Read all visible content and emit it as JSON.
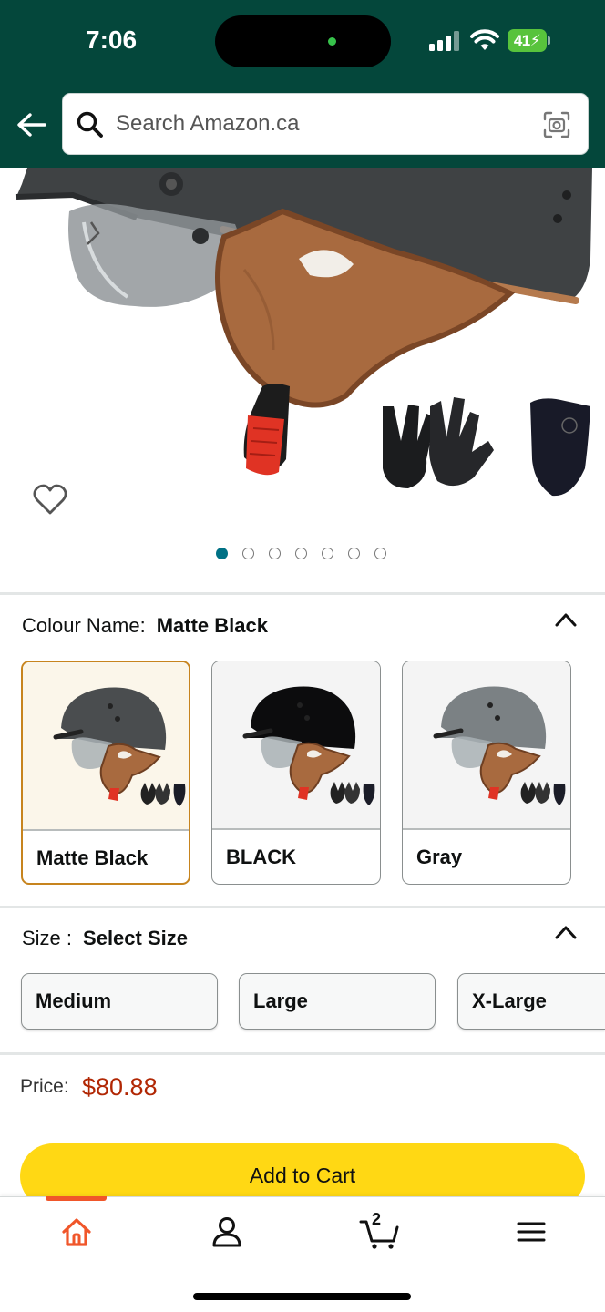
{
  "status_bar": {
    "time": "7:06",
    "battery": "41"
  },
  "search": {
    "placeholder": "Search Amazon.ca"
  },
  "gallery": {
    "image_count": 7,
    "active_index": 0
  },
  "colour": {
    "label": "Colour Name:",
    "selected": "Matte Black",
    "options": [
      {
        "label": "Matte Black",
        "shell_color": "#4a4d4f",
        "selected": true
      },
      {
        "label": "BLACK",
        "shell_color": "#0c0c0d",
        "selected": false
      },
      {
        "label": "Gray",
        "shell_color": "#7b8184",
        "selected": false
      }
    ]
  },
  "size": {
    "label": "Size :",
    "selected": "Select Size",
    "options": [
      "Medium",
      "Large",
      "X-Large"
    ]
  },
  "price": {
    "label": "Price:",
    "value": "$80.88"
  },
  "cart_button": {
    "label": "Add to Cart"
  },
  "bottom_nav": {
    "items": [
      "home-icon",
      "account-icon",
      "cart-icon",
      "menu-icon"
    ],
    "cart_count": "2",
    "active": "home-icon"
  },
  "colors": {
    "header": "#04473b",
    "accent": "#ffd814",
    "price": "#b12704",
    "link": "#007185"
  }
}
